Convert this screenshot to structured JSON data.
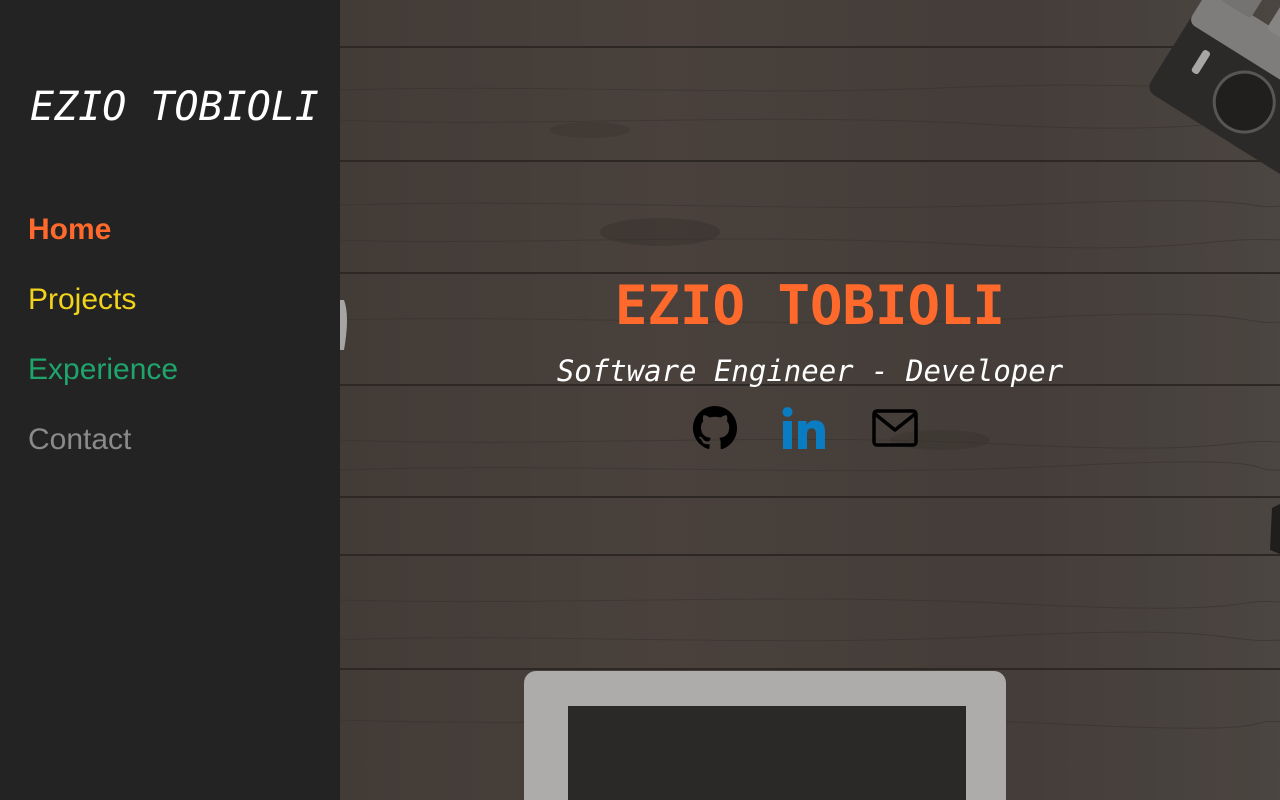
{
  "sidebar": {
    "brand": "EZIO TOBIOLI",
    "nav": [
      {
        "label": "Home",
        "color": "#ff6a2c",
        "active": true
      },
      {
        "label": "Projects",
        "color": "#f2d21b",
        "active": false
      },
      {
        "label": "Experience",
        "color": "#1fa56b",
        "active": false
      },
      {
        "label": "Contact",
        "color": "#8a8a8a",
        "active": false
      }
    ]
  },
  "hero": {
    "title": "EZIO TOBIOLI",
    "title_color": "#ff6a2c",
    "subtitle": "Software Engineer - Developer",
    "socials": [
      {
        "icon": "github-icon",
        "color": "#000000"
      },
      {
        "icon": "linkedin-icon",
        "color": "#0a7cc1"
      },
      {
        "icon": "mail-icon",
        "color": "#000000"
      }
    ]
  }
}
